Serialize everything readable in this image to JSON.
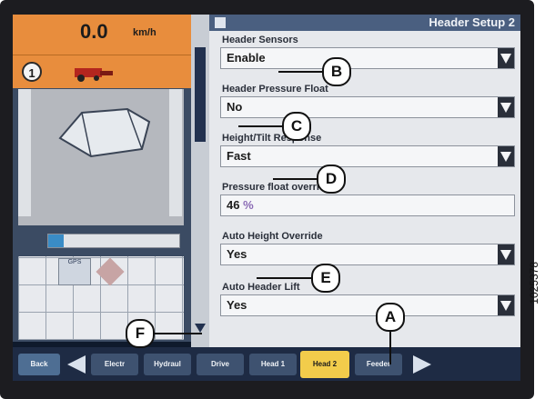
{
  "status": {
    "speed_value": "0.0",
    "speed_unit": "km/h",
    "gear": "1",
    "progress_fraction": 0.12
  },
  "sidebar": {
    "gps_label": "GPS"
  },
  "panel": {
    "title": "Header Setup 2",
    "fields": [
      {
        "label": "Header Sensors",
        "value": "Enable",
        "unit": "",
        "dropdown": true
      },
      {
        "label": "Header Pressure Float",
        "value": "No",
        "unit": "",
        "dropdown": true
      },
      {
        "label": "Height/Tilt Response",
        "value": "Fast",
        "unit": "",
        "dropdown": true
      },
      {
        "label": "Pressure float override",
        "value": "46",
        "unit": "%",
        "dropdown": false
      },
      {
        "label": "Auto Height Override",
        "value": "Yes",
        "unit": "",
        "dropdown": true
      },
      {
        "label": "Auto Header Lift",
        "value": "Yes",
        "unit": "",
        "dropdown": true
      }
    ]
  },
  "tabs": [
    {
      "label": "Back",
      "active": false
    },
    {
      "label": "Electr",
      "active": false
    },
    {
      "label": "Hydraul",
      "active": false
    },
    {
      "label": "Drive",
      "active": false
    },
    {
      "label": "Head 1",
      "active": false
    },
    {
      "label": "Head 2",
      "active": true
    },
    {
      "label": "Feeder",
      "active": false
    }
  ],
  "callouts": {
    "a": "A",
    "b": "B",
    "c": "C",
    "d": "D",
    "e": "E",
    "f": "F"
  },
  "figure_id": "1025378",
  "colors": {
    "accent_orange": "#e88d3d",
    "active_tab": "#f2cc4b",
    "title_bar": "#4a5f80"
  }
}
